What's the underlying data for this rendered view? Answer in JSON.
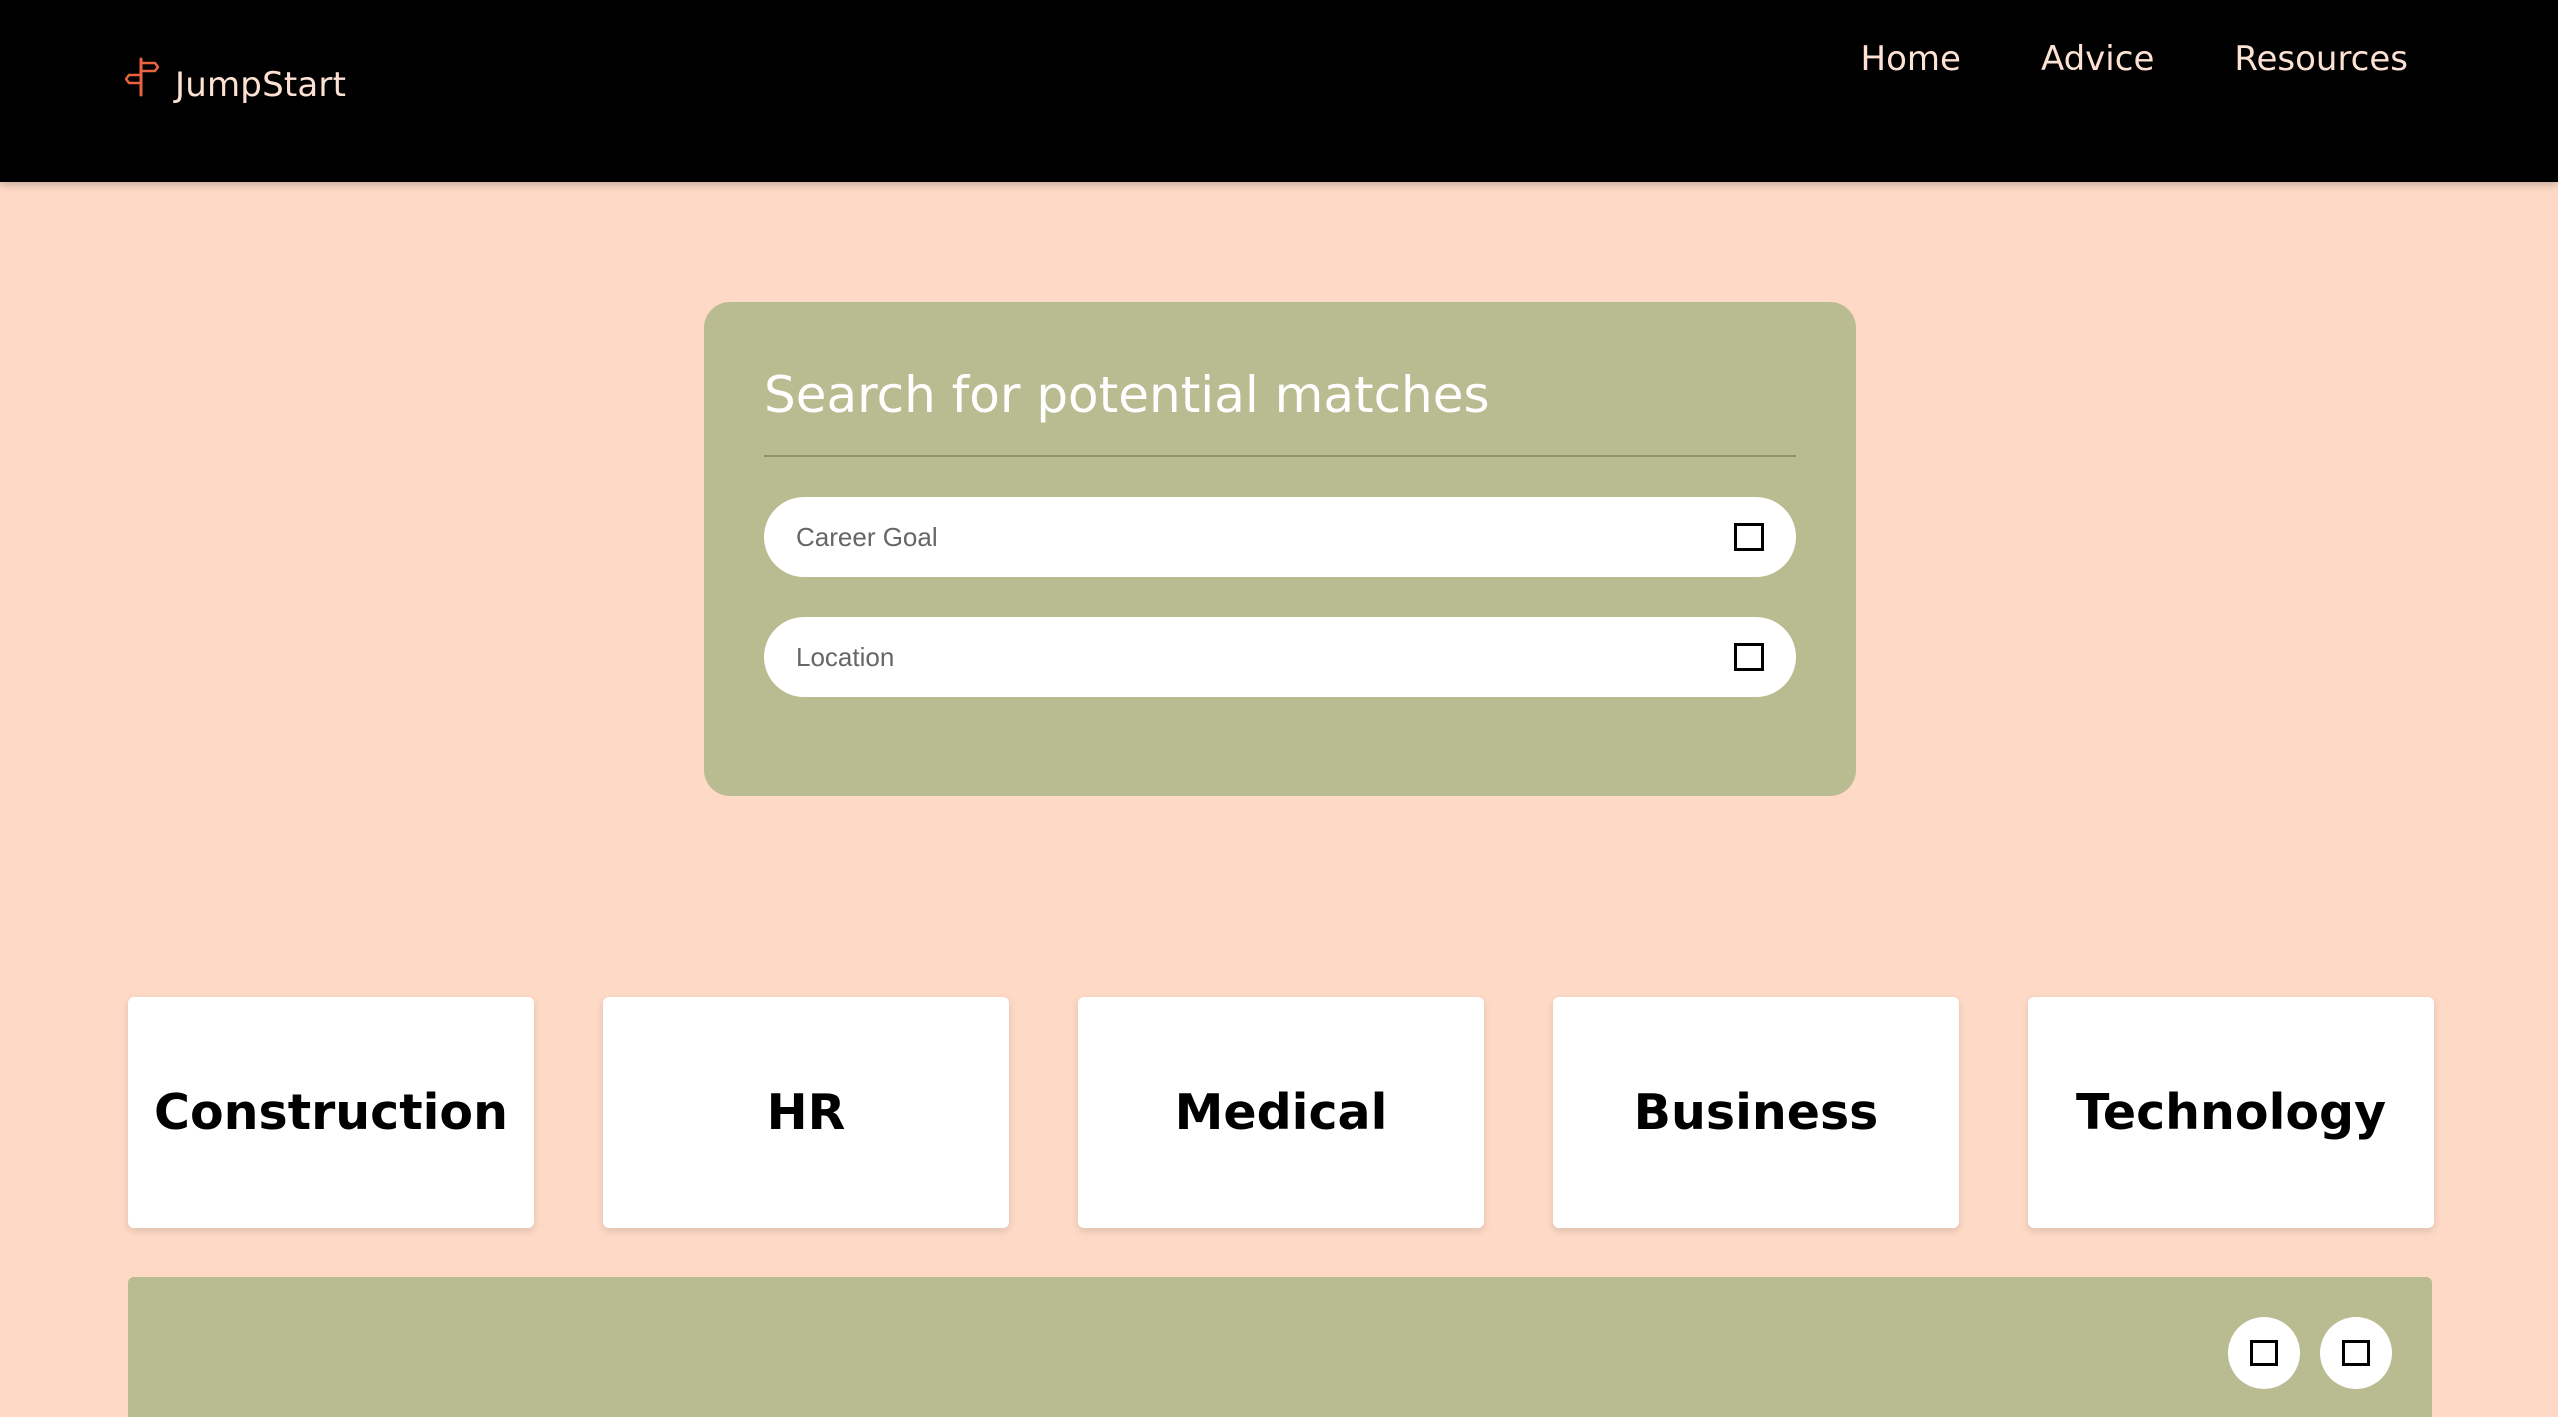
{
  "brand": {
    "name": "JumpStart",
    "icon": "signpost-icon",
    "icon_color": "#e8633f"
  },
  "nav": {
    "items": [
      {
        "label": "Home"
      },
      {
        "label": "Advice"
      },
      {
        "label": "Resources"
      }
    ]
  },
  "search": {
    "title": "Search for potential matches",
    "career_goal": {
      "placeholder": "Career Goal",
      "value": ""
    },
    "location": {
      "placeholder": "Location",
      "value": ""
    }
  },
  "categories": [
    {
      "label": "Construction"
    },
    {
      "label": "HR"
    },
    {
      "label": "Medical"
    },
    {
      "label": "Business"
    },
    {
      "label": "Technology"
    }
  ],
  "colors": {
    "background": "#fdd9c6",
    "header": "#000000",
    "panel": "#b8bc90",
    "card": "#ffffff",
    "nav_text": "#fde2d4"
  }
}
